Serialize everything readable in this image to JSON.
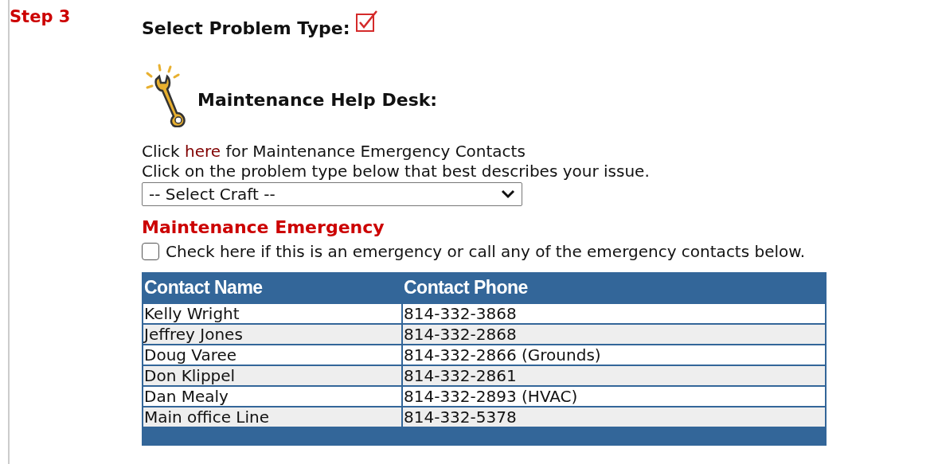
{
  "step_label": "Step 3",
  "title": "Select Problem Type:",
  "section_title": "Maintenance Help Desk:",
  "contacts_link_line": {
    "before": "Click ",
    "link": "here",
    "after": " for Maintenance Emergency Contacts"
  },
  "instruction": "Click on the problem type below that best describes your issue.",
  "craft_select": {
    "value": "-- Select Craft --"
  },
  "emergency": {
    "heading": "Maintenance Emergency",
    "checkbox_label": "Check here if this is an emergency or call any of the emergency contacts below.",
    "checked": false
  },
  "table": {
    "columns": [
      "Contact Name",
      "Contact Phone"
    ],
    "rows": [
      [
        "Kelly Wright",
        "814-332-3868"
      ],
      [
        "Jeffrey Jones",
        "814-332-2868"
      ],
      [
        "Doug Varee",
        "814-332-2866 (Grounds)"
      ],
      [
        "Don Klippel",
        "814-332-2861"
      ],
      [
        "Dan Mealy",
        "814-332-2893 (HVAC)"
      ],
      [
        "Main office Line",
        "814-332-5378"
      ]
    ]
  }
}
